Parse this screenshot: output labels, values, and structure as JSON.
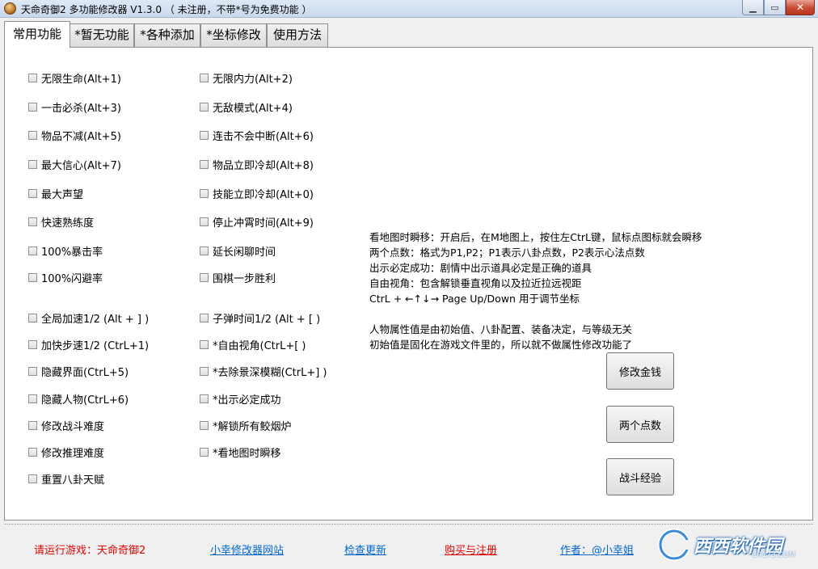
{
  "window": {
    "title": "天命奇御2 多功能修改器  V1.3.0 （ 未注册，不带*号为免费功能 ）",
    "min_icon": "minimize-icon",
    "max_icon": "maximize-icon",
    "close_icon": "close-icon"
  },
  "tabs": [
    "常用功能",
    "*暂无功能",
    "*各种添加",
    "*坐标修改",
    "使用方法"
  ],
  "left_options": [
    "无限生命(Alt+1)",
    "一击必杀(Alt+3)",
    "物品不减(Alt+5)",
    "最大信心(Alt+7)",
    "最大声望",
    "快速熟练度",
    "100%暴击率",
    "100%闪避率",
    "全局加速1/2 (Alt + ] )",
    "加快步速1/2 (CtrL+1)",
    "隐藏界面(CtrL+5)",
    "隐藏人物(CtrL+6)",
    "修改战斗难度",
    "修改推理难度",
    "重置八卦天赋"
  ],
  "right_options": [
    "无限内力(Alt+2)",
    "无敌模式(Alt+4)",
    "连击不会中断(Alt+6)",
    "物品立即冷却(Alt+8)",
    "技能立即冷却(Alt+0)",
    "停止冲霄时间(Alt+9)",
    "延长闲聊时间",
    "围棋一步胜利",
    "子弹时间1/2 (Alt + [ )",
    "*自由视角(CtrL+[ )",
    "*去除景深模糊(CtrL+] )",
    "*出示必定成功",
    "*解锁所有鲛烟炉",
    "*看地图时瞬移"
  ],
  "info_lines": [
    "看地图时瞬移：开启后，在M地图上，按住左CtrL键，鼠标点图标就会瞬移",
    "两个点数：格式为P1,P2；P1表示八卦点数，P2表示心法点数",
    "出示必定成功：剧情中出示道具必定是正确的道具",
    "自由视角：包含解锁垂直视角以及拉近拉远视距",
    "CtrL + ←↑↓→ Page Up/Down 用于调节坐标",
    "人物属性值是由初始值、八卦配置、装备决定，与等级无关",
    "初始值是固化在游戏文件里的，所以就不做属性修改功能了"
  ],
  "buttons": [
    "修改金钱",
    "两个点数",
    "战斗经验"
  ],
  "footer": {
    "status": "请运行游戏：天命奇御2",
    "status_color": "#e00000",
    "site": "小幸修改器网站",
    "update": "检查更新",
    "buy": "购买与注册",
    "author": "作者：@小幸姐",
    "link_color": "#0066cc",
    "buy_color": "#e00000"
  },
  "watermark": {
    "text": "西西软件园",
    "url": "CR173.COM"
  }
}
